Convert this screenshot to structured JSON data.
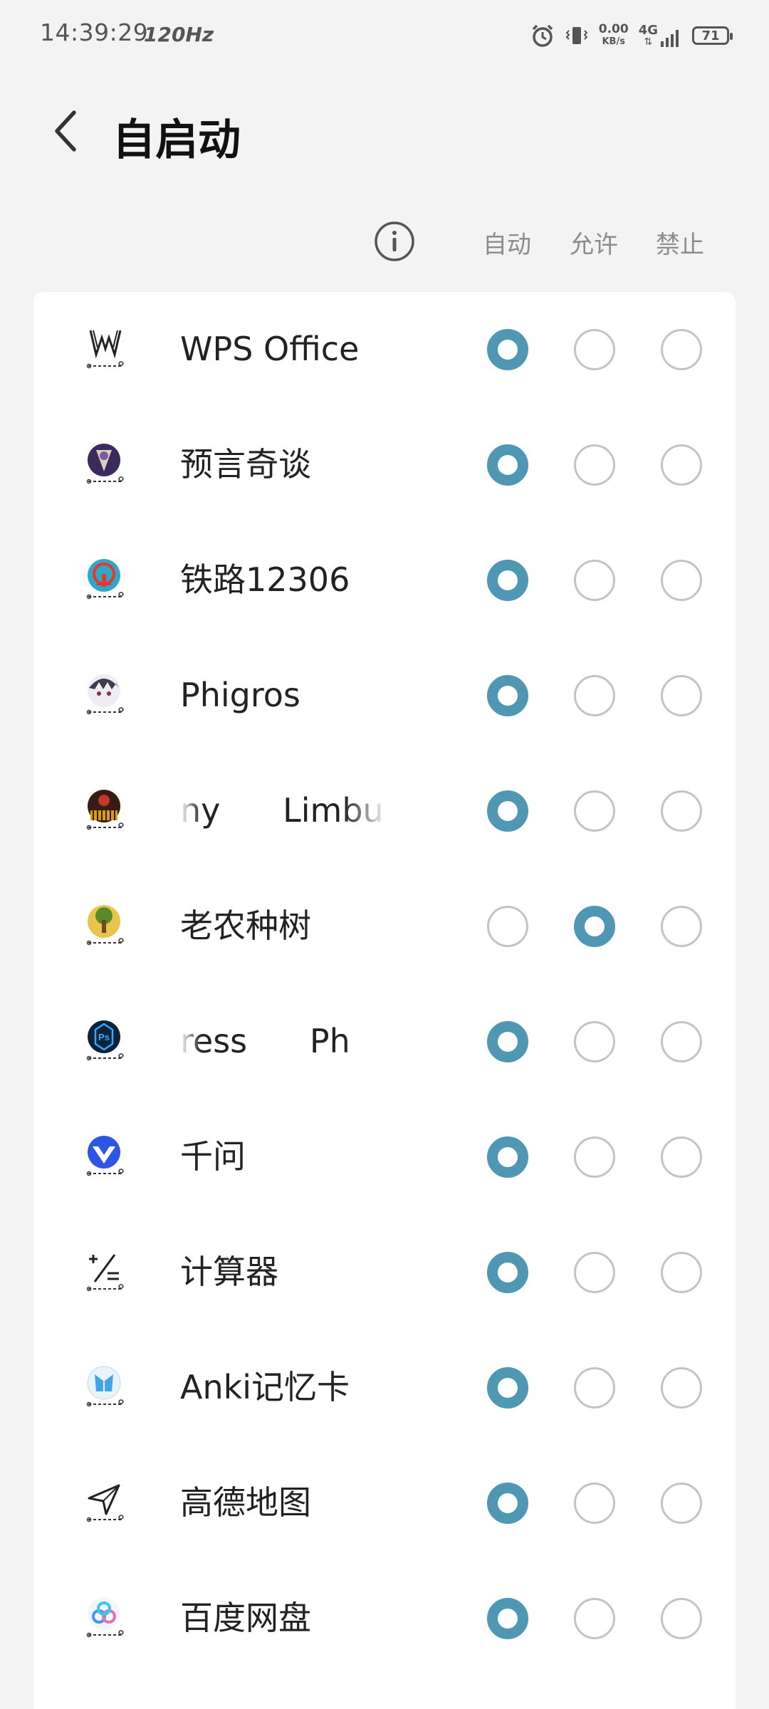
{
  "status_bar": {
    "time": "14:39:29",
    "refresh_rate": "120Hz",
    "net_speed_value": "0.00",
    "net_speed_unit": "KB/s",
    "network": "4G",
    "battery": "71"
  },
  "header": {
    "title": "自启动"
  },
  "columns": {
    "auto": "自动",
    "allow": "允许",
    "deny": "禁止"
  },
  "accent_color": "#4f97b3",
  "apps": [
    {
      "name": "WPS Office",
      "icon": "wps-icon",
      "selected": "auto"
    },
    {
      "name": "预言奇谈",
      "icon": "yuyanqitan-icon",
      "selected": "auto"
    },
    {
      "name": "铁路12306",
      "icon": "railway-12306-icon",
      "selected": "auto"
    },
    {
      "name": "Phigros",
      "icon": "phigros-icon",
      "selected": "auto"
    },
    {
      "name": "ny      Limbu",
      "icon": "limbus-icon",
      "selected": "auto"
    },
    {
      "name": "老农种树",
      "icon": "tree-icon",
      "selected": "allow"
    },
    {
      "name": "ress      Ph",
      "icon": "photoshop-express-icon",
      "selected": "auto"
    },
    {
      "name": "千问",
      "icon": "qianwen-icon",
      "selected": "auto"
    },
    {
      "name": "计算器",
      "icon": "calculator-icon",
      "selected": "auto"
    },
    {
      "name": "Anki记忆卡",
      "icon": "anki-icon",
      "selected": "auto"
    },
    {
      "name": "高德地图",
      "icon": "amap-icon",
      "selected": "auto"
    },
    {
      "name": "百度网盘",
      "icon": "baidu-netdisk-icon",
      "selected": "auto"
    }
  ]
}
